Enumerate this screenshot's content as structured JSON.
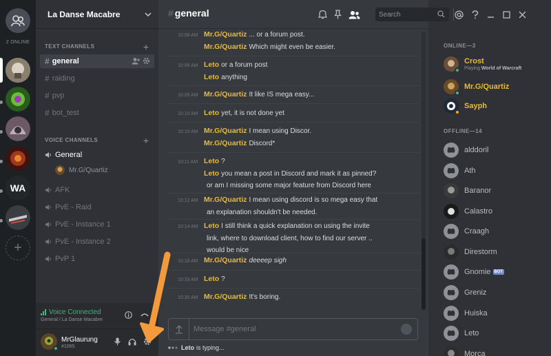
{
  "colors": {
    "accent_yellow": "#e9ba35",
    "online": "#43b581",
    "idle": "#faa61a",
    "arrow": "#f39a3c",
    "bg_chat": "#36393e",
    "bg_sidebar": "#2f3136",
    "bg_rail": "#1e2124"
  },
  "guild_rail": {
    "online_label": "2 ONLINE"
  },
  "server": {
    "name": "La Danse Macabre"
  },
  "sidebar": {
    "text_category": "TEXT CHANNELS",
    "text_channels": [
      {
        "name": "general",
        "active": true
      },
      {
        "name": "raiding"
      },
      {
        "name": "pvp"
      },
      {
        "name": "bot_test"
      }
    ],
    "voice_category": "VOICE CHANNELS",
    "voice_channels": [
      "General",
      "AFK",
      "PvE - Raid",
      "PvE - Instance 1",
      "PvE - Instance 2",
      "PvP 1"
    ],
    "voice_user": "Mr.G/Quartiz"
  },
  "voice_panel": {
    "status": "Voice Connected",
    "location": "General / La Danse Macabre"
  },
  "user_panel": {
    "username": "MrGlaurung",
    "tag": "#1065"
  },
  "chat": {
    "channel": "general",
    "hash": "#",
    "search_placeholder": "Search",
    "composer_placeholder": "Message #general",
    "typing_user": "Leto",
    "typing_suffix": "is typing...",
    "messages": [
      {
        "time": "10:08 AM",
        "lines": [
          {
            "author": "Mr.G/Quartiz",
            "text": "... or a forum post."
          },
          {
            "author": "Mr.G/Quartiz",
            "text": "Which might even be easier."
          }
        ]
      },
      {
        "time": "10:09 AM",
        "lines": [
          {
            "author": "Leto",
            "text": "or a forum post"
          },
          {
            "author": "Leto",
            "text": "anything"
          }
        ]
      },
      {
        "time": "10:09 AM",
        "lines": [
          {
            "author": "Mr.G/Quartiz",
            "text": "It like IS mega easy..."
          }
        ]
      },
      {
        "time": "10:10 AM",
        "lines": [
          {
            "author": "Leto",
            "text": "yet, it is not done yet"
          }
        ]
      },
      {
        "time": "10:10 AM",
        "lines": [
          {
            "author": "Mr.G/Quartiz",
            "text": "I mean using Discor."
          },
          {
            "author": "Mr.G/Quartiz",
            "text": "Discord*"
          }
        ]
      },
      {
        "time": "10:11 AM",
        "lines": [
          {
            "author": "Leto",
            "text": "?"
          },
          {
            "author": "Leto",
            "text": "you mean a post in Discord and mark it as pinned?",
            "wrap": "or am I missing some major feature from Discord here"
          }
        ]
      },
      {
        "time": "10:12 AM",
        "lines": [
          {
            "author": "Mr.G/Quartiz",
            "text": "I mean using discord is so mega easy that",
            "wrap": "an explanation shouldn't be needed."
          }
        ]
      },
      {
        "time": "10:14 AM",
        "lines": [
          {
            "author": "Leto",
            "text": "I still think a quick explanation on using the invite",
            "wrap": "link, where to download client, how to find our server ..",
            "wrap2": "would be nice"
          }
        ]
      },
      {
        "time": "10:18 AM",
        "lines": [
          {
            "author": "Mr.G/Quartiz",
            "text": "deeeep sigh",
            "italic": true
          }
        ]
      },
      {
        "time": "10:33 AM",
        "lines": [
          {
            "author": "Leto",
            "text": "?"
          }
        ]
      },
      {
        "time": "10:35 AM",
        "lines": [
          {
            "author": "Mr.G/Quartiz",
            "text": "It's boring."
          }
        ]
      }
    ]
  },
  "members": {
    "online_label": "ONLINE—3",
    "online": [
      {
        "name": "Crost",
        "activity_prefix": "Playing",
        "activity": "World of Warcraft",
        "status": "online"
      },
      {
        "name": "Mr.G/Quartiz",
        "status": "online"
      },
      {
        "name": "Sayph",
        "status": "idle"
      }
    ],
    "offline_label": "OFFLINE—14",
    "offline": [
      {
        "name": "alddoril"
      },
      {
        "name": "Ath"
      },
      {
        "name": "Baranor"
      },
      {
        "name": "Calastro"
      },
      {
        "name": "Craagh"
      },
      {
        "name": "Direstorm"
      },
      {
        "name": "Gnomie",
        "bot": "BOT"
      },
      {
        "name": "Greniz"
      },
      {
        "name": "Huiska"
      },
      {
        "name": "Leto"
      },
      {
        "name": "Morca"
      }
    ]
  }
}
